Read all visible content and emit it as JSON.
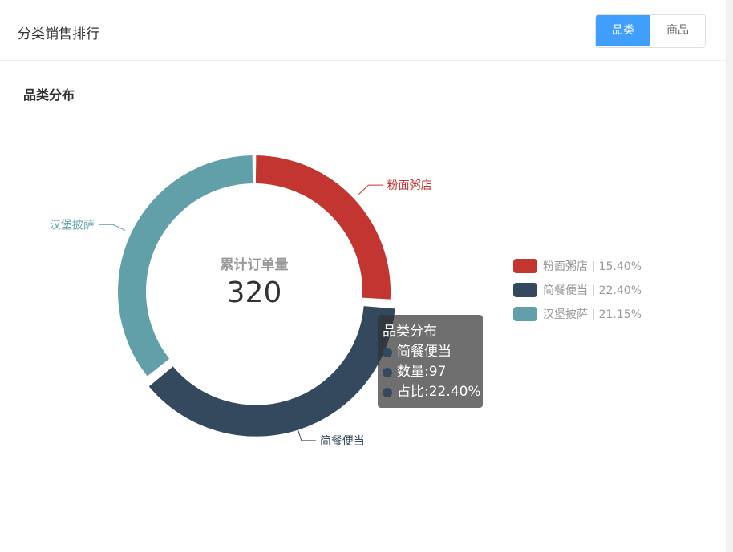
{
  "header": {
    "title": "分类销售排行"
  },
  "tabs": [
    {
      "label": "品类",
      "active": true
    },
    {
      "label": "商品",
      "active": false
    }
  ],
  "section_title": "品类分布",
  "center": {
    "label": "累计订单量",
    "value": "320"
  },
  "tooltip": {
    "title": "品类分布",
    "name": "简餐便当",
    "count_text": "数量:97",
    "pct_text": "占比:22.40%",
    "color": "#34495e"
  },
  "chart_data": {
    "type": "pie",
    "title": "品类分布",
    "total": 320,
    "slices": [
      {
        "name": "粉面粥店",
        "percent": 15.4,
        "legend": "粉面粥店 | 15.40%",
        "color": "#c23531"
      },
      {
        "name": "简餐便当",
        "percent": 22.4,
        "value": 97,
        "legend": "简餐便当 | 22.40%",
        "color": "#34495e"
      },
      {
        "name": "汉堡披萨",
        "percent": 21.15,
        "legend": "汉堡披萨 | 21.15%",
        "color": "#61a0a8"
      }
    ],
    "legend_position": "right"
  }
}
